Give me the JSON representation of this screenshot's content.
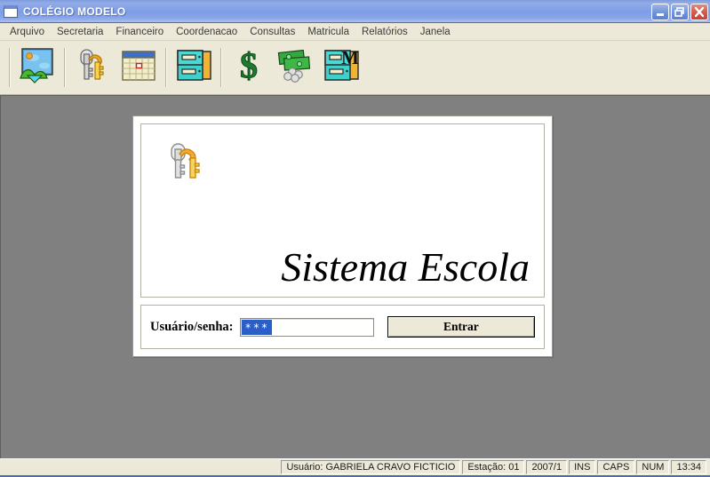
{
  "window": {
    "title": "COLÉGIO MODELO",
    "icon": "window-document-icon",
    "controls": {
      "minimize": "Minimizar",
      "restore": "Restaurar",
      "close": "Fechar"
    }
  },
  "menu": {
    "items": [
      {
        "label": "Arquivo"
      },
      {
        "label": "Secretaria"
      },
      {
        "label": "Financeiro"
      },
      {
        "label": "Coordenacao"
      },
      {
        "label": "Consultas"
      },
      {
        "label": "Matricula"
      },
      {
        "label": "Relatórios"
      },
      {
        "label": "Janela"
      }
    ]
  },
  "toolbar": {
    "buttons": [
      {
        "icon": "picture-landscape-icon",
        "name": "tb-picture"
      },
      {
        "separator": true
      },
      {
        "icon": "keys-icon",
        "name": "tb-keys"
      },
      {
        "icon": "calendar-icon",
        "name": "tb-calendar"
      },
      {
        "separator": true
      },
      {
        "icon": "file-cabinet-icon",
        "name": "tb-cabinet"
      },
      {
        "separator": true
      },
      {
        "icon": "dollar-sign-icon",
        "name": "tb-dollar"
      },
      {
        "icon": "money-cash-icon",
        "name": "tb-money"
      },
      {
        "icon": "file-cabinet-m-icon",
        "name": "tb-cabinet-m"
      }
    ]
  },
  "login": {
    "logo_icon": "keys-icon",
    "brand_title": "Sistema Escola",
    "credentials_label": "Usuário/senha:",
    "password_value": "***",
    "password_placeholder": "",
    "submit_label": "Entrar"
  },
  "status_bar": {
    "cells": [
      {
        "text": "Usuário: GABRIELA CRAVO FICTICIO",
        "name": "status-user"
      },
      {
        "text": "Estação: 01",
        "name": "status-station"
      },
      {
        "text": "2007/1",
        "name": "status-period"
      },
      {
        "text": "INS",
        "name": "status-insert-mode"
      },
      {
        "text": "CAPS",
        "name": "status-caps"
      },
      {
        "text": "NUM",
        "name": "status-num"
      },
      {
        "text": "13:34",
        "name": "status-clock"
      }
    ]
  },
  "colors": {
    "title_bar_blue": "#7e9de5",
    "chrome_beige": "#ece9d8",
    "mdi_gray": "#808080",
    "close_red": "#c04335",
    "selection_blue": "#2a5fc8"
  }
}
